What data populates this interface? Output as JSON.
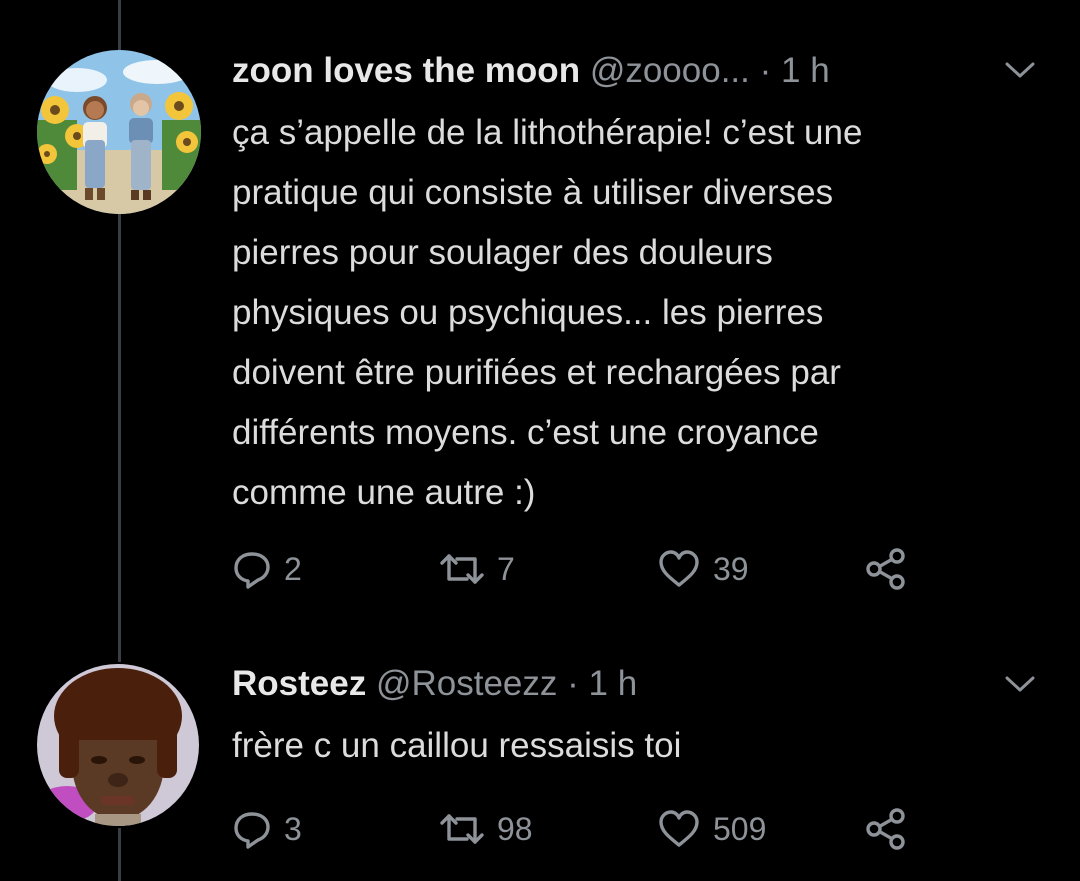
{
  "tweets": [
    {
      "display_name": "zoon loves the moon",
      "handle": "@zoooo...",
      "separator": "·",
      "time": "1 h",
      "text": "ça s’appelle de la lithothérapie! c’est une\npratique qui consiste à utiliser diverses\npierres pour soulager des douleurs\nphysiques ou psychiques... les pierres\ndoivent être purifiées et rechargées par\ndifférents moyens. c’est une croyance\ncomme une autre :)",
      "replies": "2",
      "retweets": "7",
      "likes": "39"
    },
    {
      "display_name": "Rosteez",
      "handle": "@Rosteezz",
      "separator": "·",
      "time": "1 h",
      "text": "frère c un caillou ressaisis toi",
      "replies": "3",
      "retweets": "98",
      "likes": "509"
    }
  ],
  "icons": {
    "reply": "reply-icon",
    "retweet": "retweet-icon",
    "like": "heart-icon",
    "share": "share-icon",
    "menu": "chevron-down-icon"
  },
  "colors": {
    "background": "#000000",
    "text": "#dcdcdc",
    "muted": "#8e9399",
    "thread_line": "#3a3d41"
  }
}
